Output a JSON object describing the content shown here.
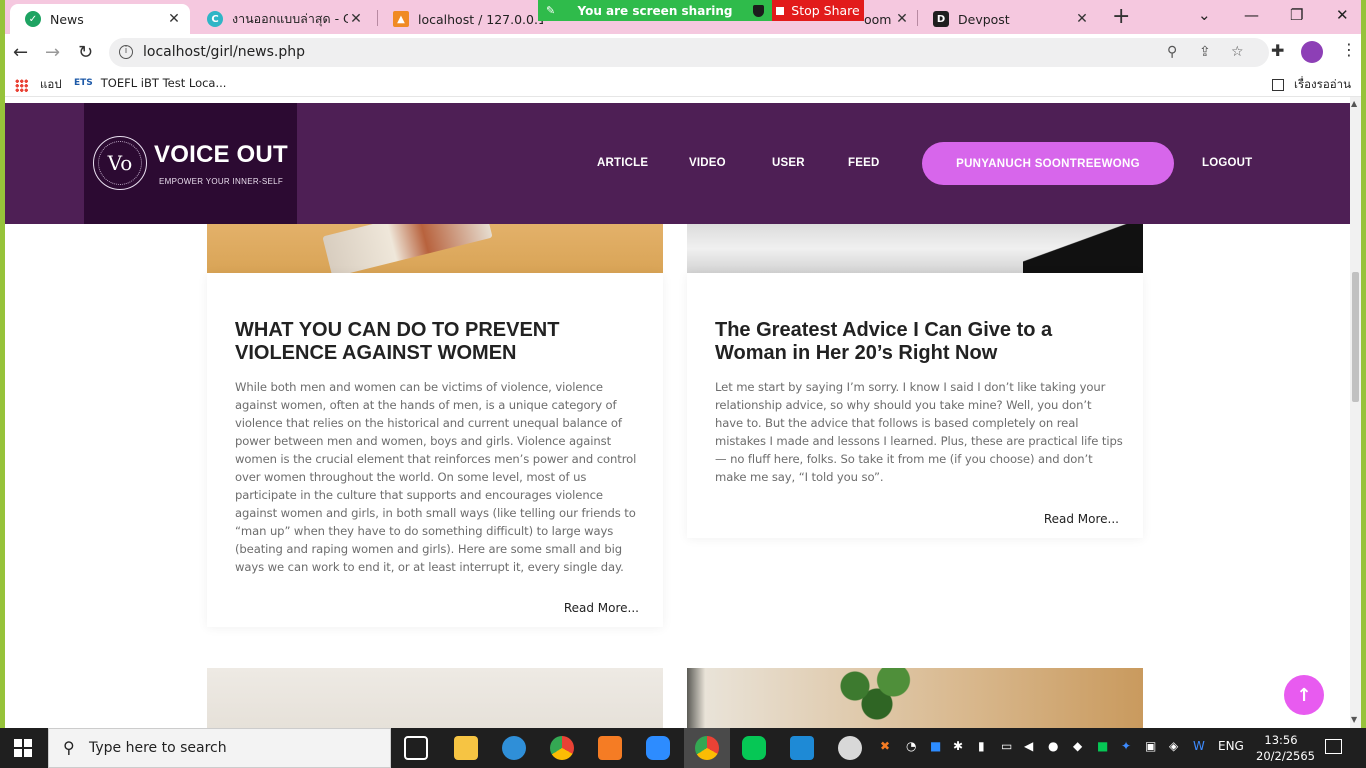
{
  "browser": {
    "tabs": [
      {
        "title": "News",
        "active": true,
        "fav_color": "#1ea362"
      },
      {
        "title": "งานออกแบบล่าสุด - Canva",
        "fav_color": "#2fb5c6"
      },
      {
        "title": "localhost / 127.0.0.1 / ",
        "fav_color": "#f08a24"
      },
      {
        "title": "oom",
        "fav_color": "#2d8cff"
      },
      {
        "title": "Devpost",
        "fav_color": "#1f1f1f"
      }
    ],
    "close_glyph": "✕",
    "new_tab_glyph": "+",
    "url": "localhost/girl/news.php",
    "bookmarks": [
      {
        "label": "แอป"
      },
      {
        "label": "TOEFL iBT Test Loca..."
      }
    ],
    "reading_list": "เรื่องรออ่าน"
  },
  "share": {
    "sharing_text": "You are screen sharing",
    "stop_label": "Stop Share"
  },
  "site": {
    "logo_mark": "Vo",
    "logo_title": "VOICE OUT",
    "logo_tagline": "EMPOWER YOUR INNER-SELF",
    "nav": {
      "article": "ARTICLE",
      "video": "VIDEO",
      "user": "USER",
      "feed": "FEED",
      "user_name": "PUNYANUCH SOONTREEWONG",
      "logout": "LOGOUT"
    },
    "accent_color": "#d766eb",
    "header_color": "#4e1f55"
  },
  "articles": [
    {
      "title": "WHAT YOU CAN DO TO PREVENT VIOLENCE AGAINST WOMEN",
      "body": "While both men and women can be victims of violence, violence against women, often at the hands of men, is a unique category of violence that relies on the historical and current unequal balance of power between men and women, boys and girls. Violence against women is the crucial element that reinforces men’s power and control over women throughout the world. On some level, most of us participate in the culture that supports and encourages violence against women and girls, in both small ways (like telling our friends to “man up” when they have to do something difficult) to large ways (beating and raping women and girls). Here are some small and big ways we can work to end it, or at least interrupt it, every single day.",
      "read_more": "Read More..."
    },
    {
      "title": "The Greatest Advice I Can Give to a Woman in Her 20’s Right Now",
      "body": "Let me start by saying I’m sorry. I know I said I don’t like taking your relationship advice, so why should you take mine? Well, you don’t have to. But the advice that follows is based completely on real mistakes I made and lessons I learned. Plus, these are practical life tips — no fluff here, folks. So take it from me (if you choose) and don’t make me say, “I told you so”.",
      "read_more": "Read More..."
    }
  ],
  "taskbar": {
    "search_placeholder": "Type here to search",
    "language": "ENG",
    "time": "13:56",
    "date": "20/2/2565"
  }
}
